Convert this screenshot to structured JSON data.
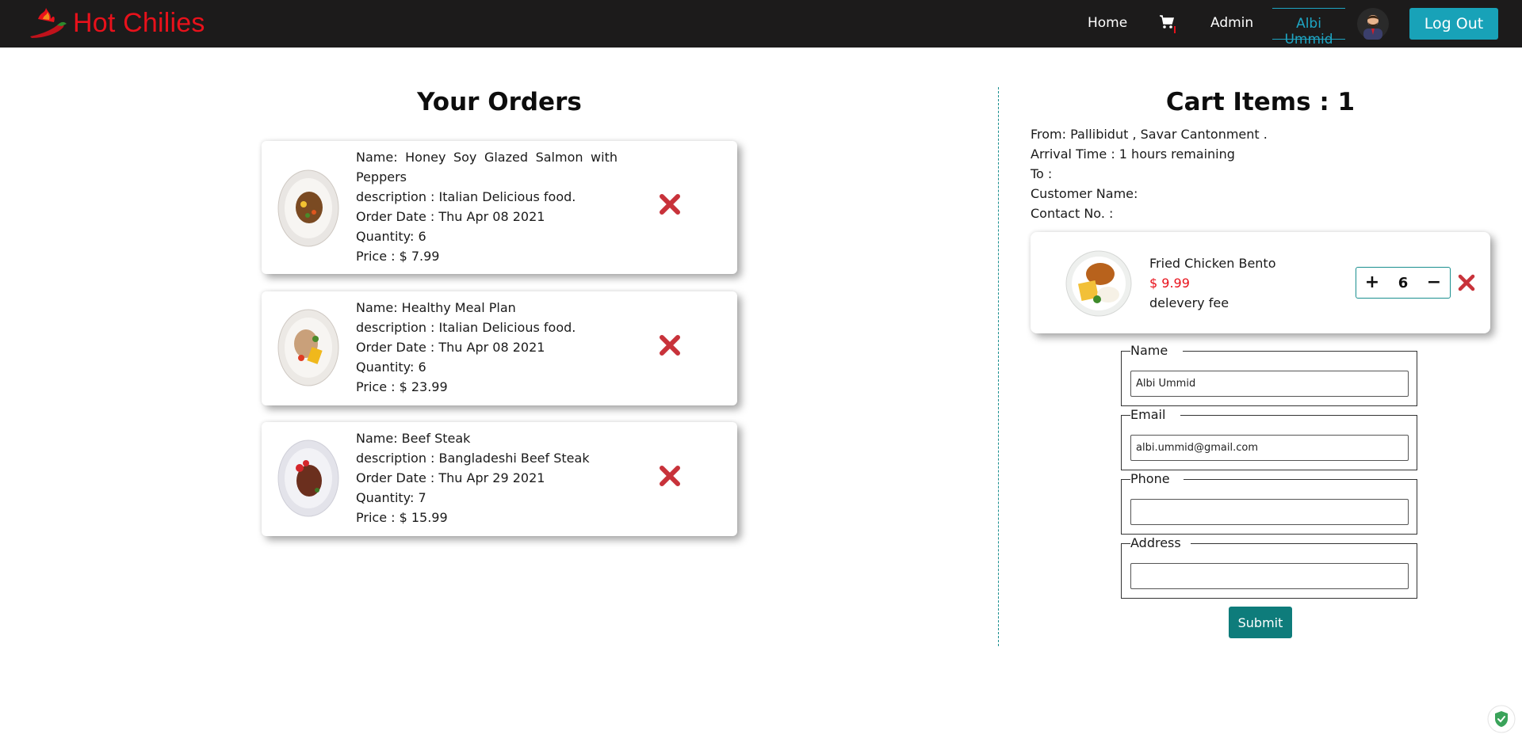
{
  "nav": {
    "brand": "Hot Chilies",
    "home": "Home",
    "admin": "Admin",
    "user": "Albi Ummid",
    "logout": "Log Out"
  },
  "orders": {
    "title": "Your Orders",
    "items": [
      {
        "name": "Name: Honey Soy Glazed Salmon with Peppers",
        "description": "description : Italian Delicious food.",
        "date": "Order Date : Thu Apr 08 2021",
        "quantity": "Quantity: 6",
        "price": "Price : $ 7.99"
      },
      {
        "name": "Name: Healthy Meal Plan",
        "description": "description : Italian Delicious food.",
        "date": "Order Date : Thu Apr 08 2021",
        "quantity": "Quantity: 6",
        "price": "Price : $ 23.99"
      },
      {
        "name": "Name: Beef Steak",
        "description": "description : Bangladeshi Beef Steak",
        "date": "Order Date : Thu Apr 29 2021",
        "quantity": "Quantity: 7",
        "price": "Price : $ 15.99"
      }
    ]
  },
  "cart": {
    "title": "Cart Items : 1",
    "from": "From: Pallibidut , Savar Cantonment .",
    "arrival": "Arrival Time : 1 hours remaining",
    "to": "To :",
    "customer": "Customer Name:",
    "contact": "Contact No. :",
    "item": {
      "name": "Fried Chicken Bento",
      "price": "$ 9.99",
      "fee": "delevery fee",
      "plus": "+",
      "quantity": "6",
      "minus": "−"
    }
  },
  "form": {
    "name_label": "Name",
    "name_value": "Albi Ummid",
    "email_label": "Email",
    "email_value": "albi.ummid@gmail.com",
    "phone_label": "Phone",
    "phone_value": "",
    "address_label": "Address",
    "address_value": "",
    "submit": "Submit"
  },
  "colors": {
    "brand_red": "#e8111b",
    "nav_bg": "#1c1b1b",
    "accent_cyan": "#1ea5c3",
    "logout_bg": "#18a2b8",
    "submit_bg": "#0e7c7b",
    "delete_red": "#c8323a"
  }
}
